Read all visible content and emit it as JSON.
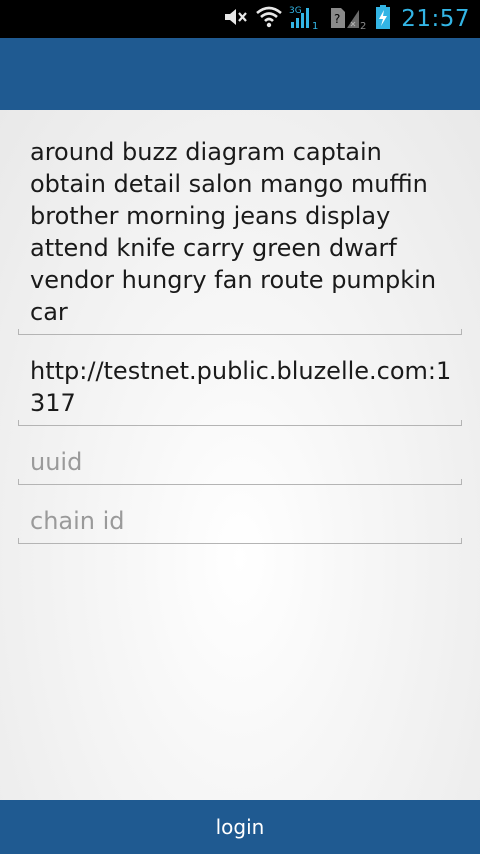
{
  "status_bar": {
    "time": "21:57",
    "icons": [
      "mute-icon",
      "wifi-icon",
      "signal-3g-icon",
      "no-sim-icon",
      "battery-charging-icon"
    ],
    "network_label": "3G",
    "sim1_badge": "1",
    "sim2_badge": "2",
    "accent_color": "#33b5e5"
  },
  "app_bar": {
    "color": "#1f5a91"
  },
  "form": {
    "mnemonic_value": "around buzz diagram captain obtain detail salon mango muffin brother morning jeans display attend knife carry green dwarf vendor hungry fan route pumpkin car",
    "endpoint_value": "http://testnet.public.bluzelle.com:1317",
    "uuid_placeholder": "uuid",
    "chain_id_placeholder": "chain id"
  },
  "login_button": {
    "label": "login"
  }
}
